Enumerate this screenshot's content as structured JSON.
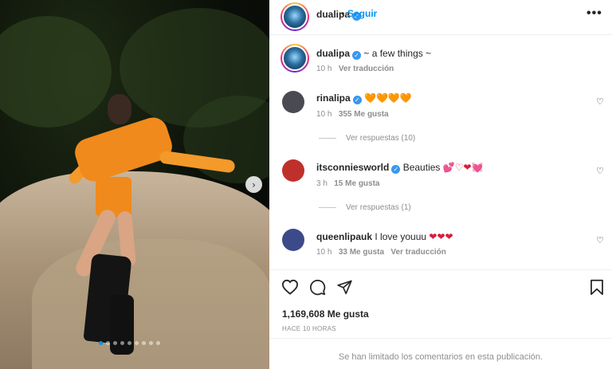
{
  "post": {
    "author": "dualipa",
    "separator": "•",
    "follow_label": "Seguir",
    "more_icon": "•••",
    "caption": "~ a few things ~",
    "caption_time": "10 h",
    "caption_translate": "Ver traducción"
  },
  "comments": [
    {
      "user": "rinalipa",
      "text": "",
      "emoji": "🧡🧡🧡🧡",
      "time": "10 h",
      "likes": "355 Me gusta",
      "extra": "",
      "replies": "Ver respuestas (10)",
      "avatar_color": "#4a4a52"
    },
    {
      "user": "itsconniesworld",
      "text": "Beauties ",
      "emoji": "💕♡❤💓",
      "time": "3 h",
      "likes": "15 Me gusta",
      "extra": "",
      "replies": "Ver respuestas (1)",
      "avatar_color": "#c0302a"
    },
    {
      "user": "queenlipauk",
      "text": "I love youuu ",
      "emoji": "❤❤❤",
      "time": "10 h",
      "likes": "33 Me gusta",
      "extra": "Ver traducción",
      "replies": "",
      "avatar_color": "#3c4a8a"
    }
  ],
  "stats": {
    "likes": "1,169,608 Me gusta",
    "posted_ago": "HACE 10 HORAS"
  },
  "footer": {
    "limited_text": "Se han limitado los comentarios en esta publicación."
  },
  "carousel": {
    "next_icon": "›",
    "slides": 9,
    "current": 1
  }
}
